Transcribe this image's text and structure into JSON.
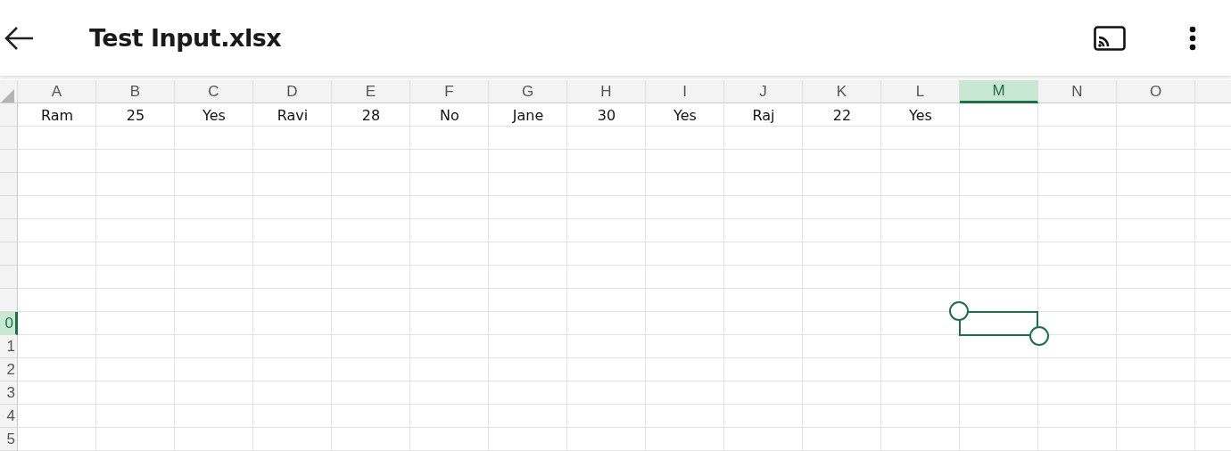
{
  "app_bar": {
    "title": "Test Input.xlsx"
  },
  "columns": [
    {
      "label": "A",
      "selected": false
    },
    {
      "label": "B",
      "selected": false
    },
    {
      "label": "C",
      "selected": false
    },
    {
      "label": "D",
      "selected": false
    },
    {
      "label": "E",
      "selected": false
    },
    {
      "label": "F",
      "selected": false
    },
    {
      "label": "G",
      "selected": false
    },
    {
      "label": "H",
      "selected": false
    },
    {
      "label": "I",
      "selected": false
    },
    {
      "label": "J",
      "selected": false
    },
    {
      "label": "K",
      "selected": false
    },
    {
      "label": "L",
      "selected": false
    },
    {
      "label": "M",
      "selected": true
    },
    {
      "label": "N",
      "selected": false
    },
    {
      "label": "O",
      "selected": false
    }
  ],
  "rows": [
    {
      "selected": false,
      "cells": [
        "Ram",
        "25",
        "Yes",
        "Ravi",
        "28",
        "No",
        "Jane",
        "30",
        "Yes",
        "Raj",
        "22",
        "Yes"
      ]
    },
    {
      "selected": false,
      "cells": []
    },
    {
      "selected": false,
      "cells": []
    },
    {
      "selected": false,
      "cells": []
    },
    {
      "selected": false,
      "cells": []
    },
    {
      "selected": false,
      "cells": []
    },
    {
      "selected": false,
      "cells": []
    },
    {
      "selected": false,
      "cells": []
    },
    {
      "selected": false,
      "cells": []
    },
    {
      "label": "0",
      "selected": true,
      "cells": []
    },
    {
      "label": "1",
      "selected": false,
      "cells": []
    },
    {
      "label": "2",
      "selected": false,
      "cells": []
    },
    {
      "label": "3",
      "selected": false,
      "cells": []
    },
    {
      "label": "4",
      "selected": false,
      "cells": []
    },
    {
      "label": "5",
      "selected": false,
      "cells": []
    }
  ]
}
